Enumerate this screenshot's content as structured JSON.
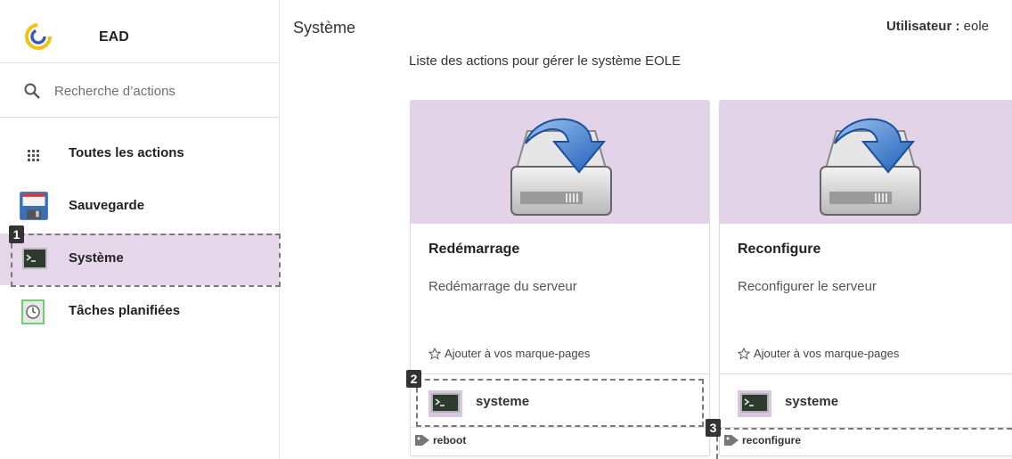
{
  "app": {
    "name": "EAD"
  },
  "search": {
    "placeholder": "Recherche d’actions"
  },
  "sidebar": {
    "items": [
      {
        "label": "Toutes les actions",
        "icon": "grid-icon"
      },
      {
        "label": "Sauvegarde",
        "icon": "floppy-disk-icon"
      },
      {
        "label": "Système",
        "icon": "terminal-icon",
        "active": true
      },
      {
        "label": "Tâches planifiées",
        "icon": "clock-icon"
      }
    ]
  },
  "header": {
    "title": "Système",
    "user_label": "Utilisateur :",
    "user_name": "eole"
  },
  "main": {
    "description": "Liste des actions pour gérer le système EOLE",
    "cards": [
      {
        "title": "Redémarrage",
        "description": "Redémarrage du serveur",
        "bookmark_label": "Ajouter à vos marque-pages",
        "module": "systeme",
        "tag": "reboot"
      },
      {
        "title": "Reconfigure",
        "description": "Reconfigurer le serveur",
        "bookmark_label": "Ajouter à vos marque-pages",
        "module": "systeme",
        "tag": "reconfigure"
      }
    ]
  },
  "markers": [
    "1",
    "2",
    "3"
  ],
  "colors": {
    "accent": "#e6d6ea",
    "banner": "#e2d3e8",
    "logo_yellow": "#f3c312",
    "logo_blue": "#3b5bb5"
  }
}
